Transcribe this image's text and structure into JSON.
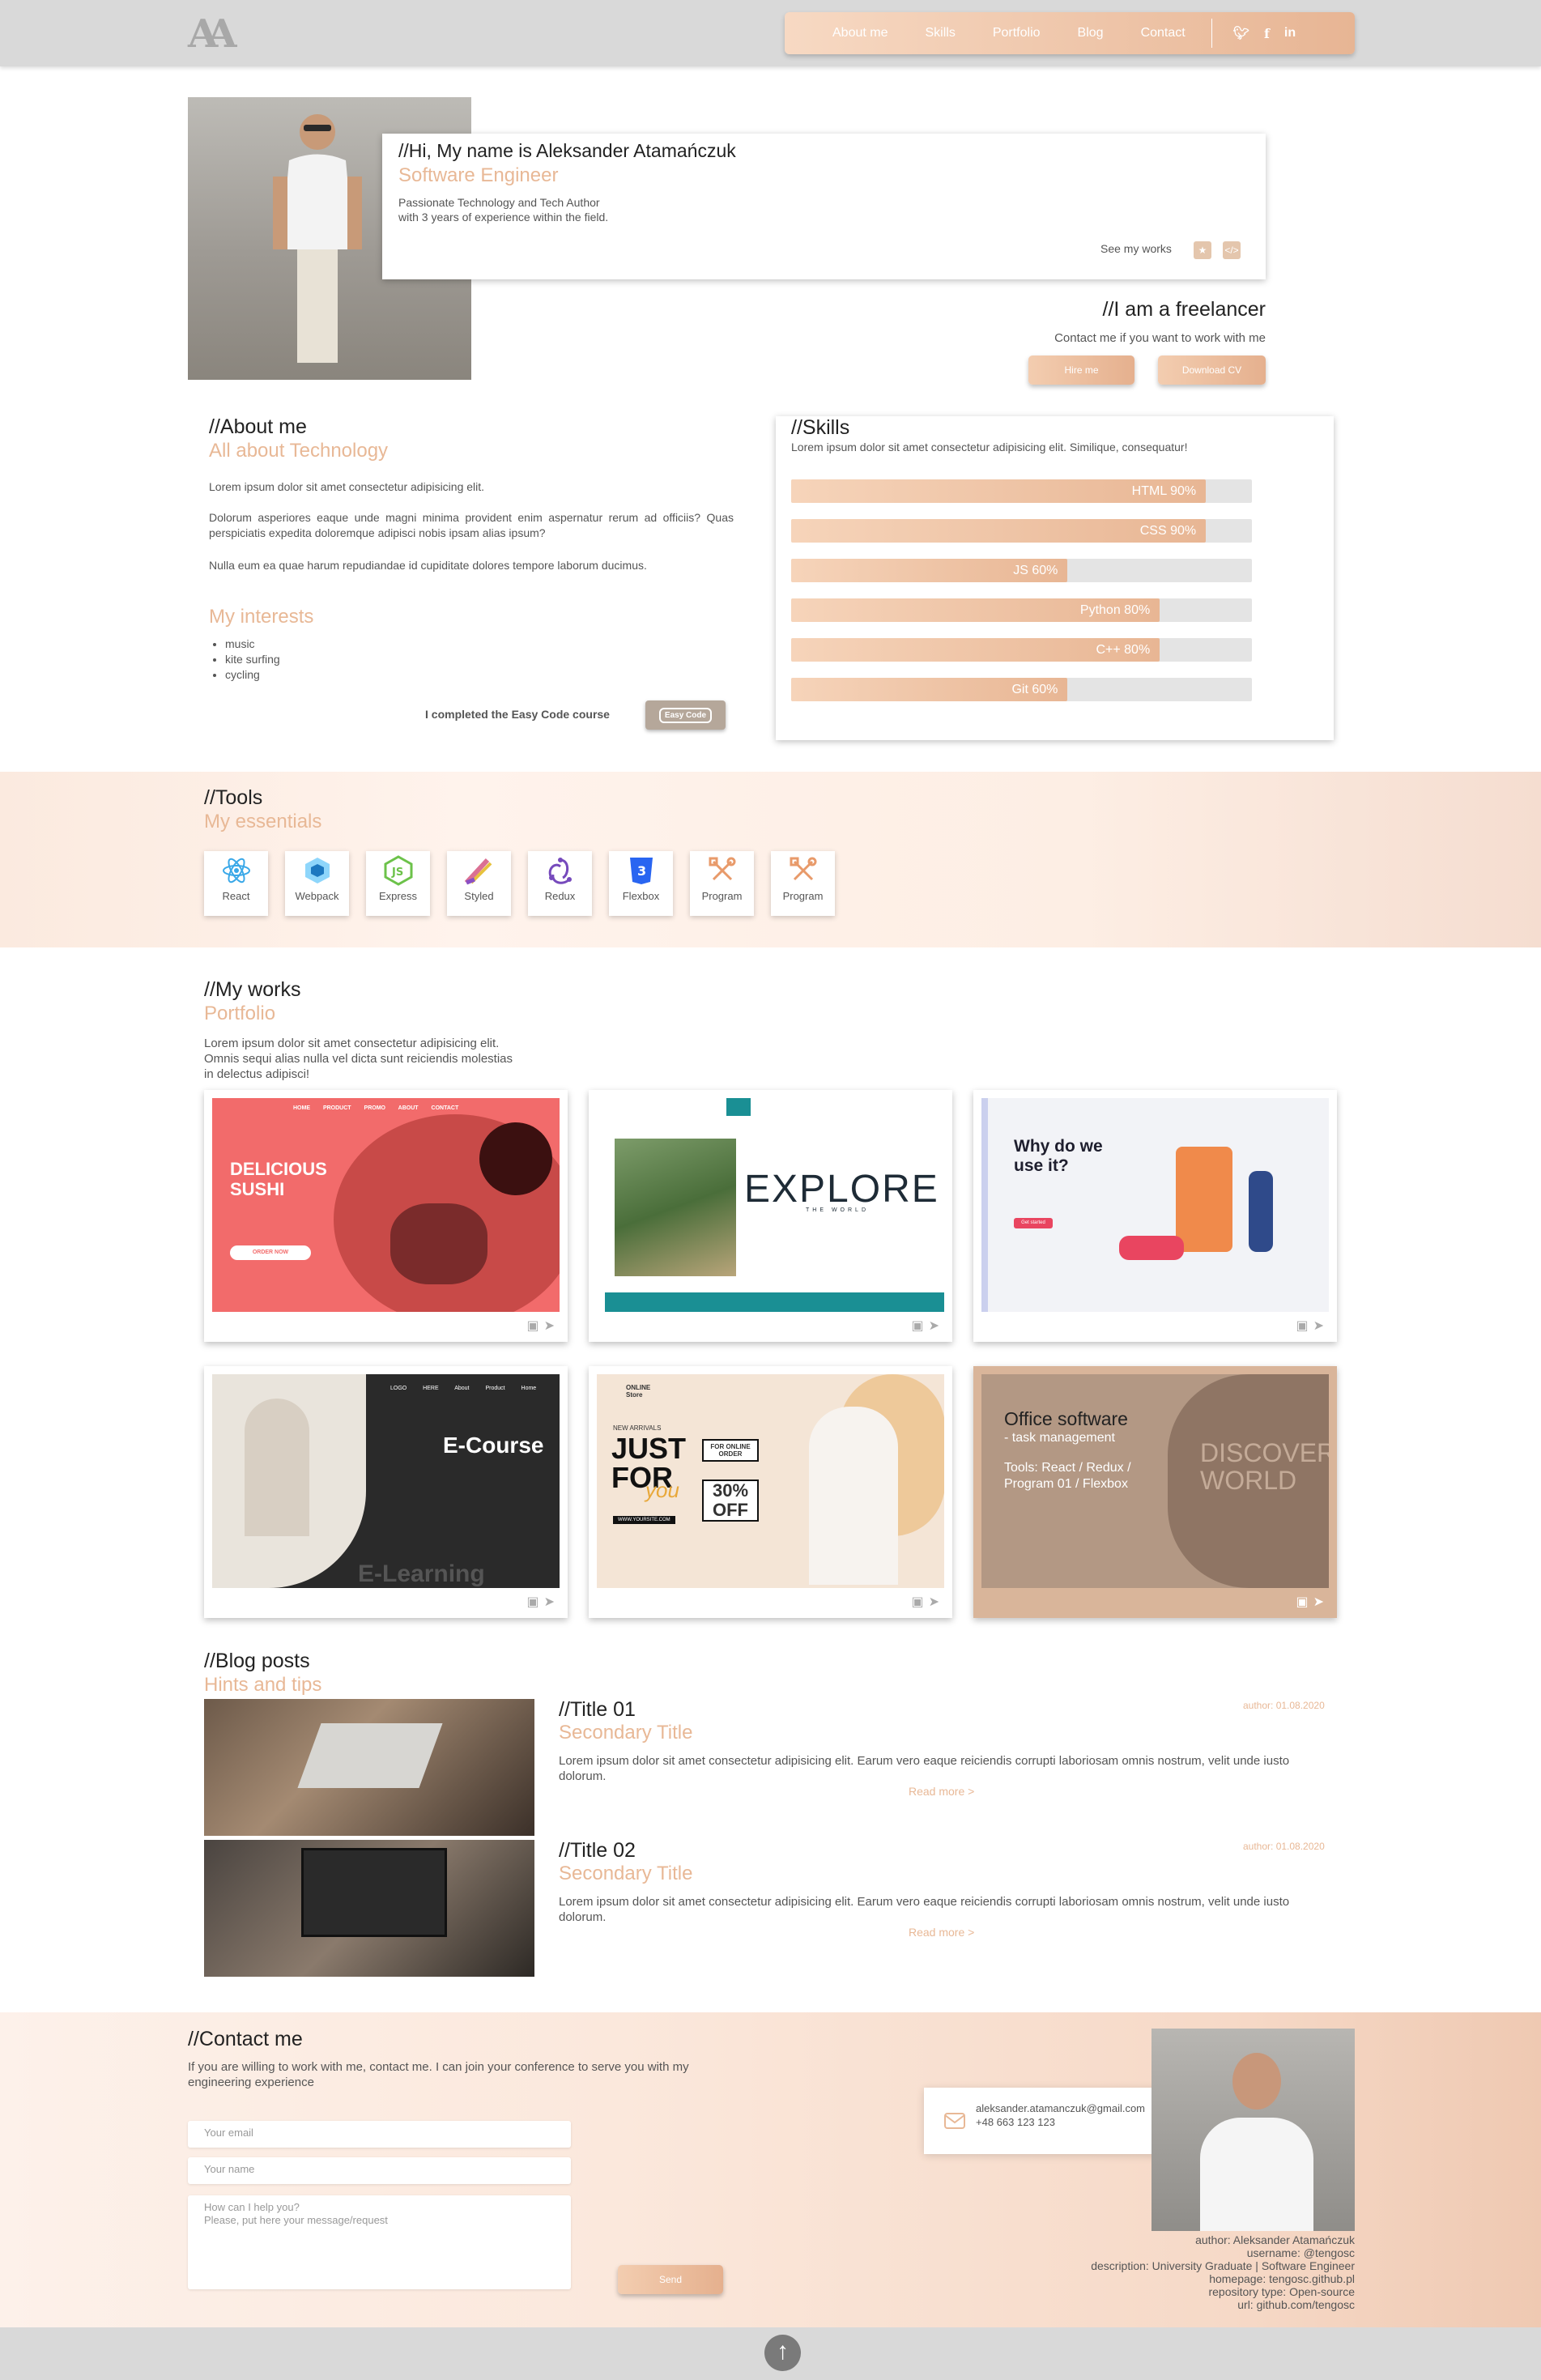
{
  "header": {
    "logo": "AA",
    "nav": [
      "About me",
      "Skills",
      "Portfolio",
      "Blog",
      "Contact"
    ],
    "social": [
      "twitter-icon",
      "facebook-icon",
      "linkedin-icon"
    ]
  },
  "hero": {
    "greeting": "//Hi, My name is Aleksander Atamańczuk",
    "role": "Software Engineer",
    "desc1": "Passionate Technology and Tech Author",
    "desc2": "with 3 years of experience within the field.",
    "see_works": "See my works",
    "freelancer_title": "//I am a freelancer",
    "freelancer_text": "Contact me if you want to work with me",
    "hire": "Hire me",
    "cv": "Download CV"
  },
  "about": {
    "title": "//About me",
    "subtitle": "All about Technology",
    "p1": "Lorem ipsum dolor sit amet consectetur adipisicing elit.",
    "p2": "Dolorum asperiores eaque unde magni minima provident enim aspernatur rerum ad officiis? Quas perspiciatis expedita doloremque adipisci nobis ipsam alias ipsum?",
    "p3": "Nulla eum ea quae harum repudiandae id cupiditate dolores tempore laborum ducimus.",
    "interests_title": "My interests",
    "interests": [
      "music",
      "kite surfing",
      "cycling"
    ],
    "course_text": "I completed the Easy Code course",
    "course_badge": "Easy Code"
  },
  "skills": {
    "title": "//Skills",
    "desc": "Lorem ipsum dolor sit amet consectetur adipisicing elit. Similique, consequatur!",
    "items": [
      {
        "label": "HTML 90%",
        "value": 90
      },
      {
        "label": "CSS 90%",
        "value": 90
      },
      {
        "label": "JS 60%",
        "value": 60
      },
      {
        "label": "Python 80%",
        "value": 80
      },
      {
        "label": "C++ 80%",
        "value": 80
      },
      {
        "label": "Git 60%",
        "value": 60
      }
    ]
  },
  "tools": {
    "title": "//Tools",
    "subtitle": "My essentials",
    "items": [
      "React",
      "Webpack",
      "Express",
      "Styled",
      "Redux",
      "Flexbox",
      "Program",
      "Program"
    ]
  },
  "works": {
    "title": "//My works",
    "subtitle": "Portfolio",
    "desc": "Lorem ipsum dolor sit amet consectetur adipisicing elit. Omnis sequi alias nulla vel dicta sunt reiciendis molestias in delectus adipisci!",
    "sushi_title": "DELICIOUS SUSHI",
    "sushi_btn": "ORDER NOW",
    "sushi_nav": [
      "HOME",
      "PRODUCT",
      "PROMO",
      "ABOUT",
      "CONTACT"
    ],
    "explore": "EXPLORE",
    "explore_sub": "THE WORLD",
    "why_title": "Why do we use it?",
    "why_btn": "Get started",
    "ecourse": "E-Course",
    "ecourse_bottom": "E-Learning",
    "ecourse_nav": [
      "LOGO HERE",
      "About",
      "Product",
      "Home"
    ],
    "fashion_new": "NEW ARRIVALS",
    "fashion_big": "JUST FOR",
    "fashion_you": "you",
    "fashion_online": "FOR ONLINE ORDER",
    "fashion_off": "30% OFF",
    "fashion_logo": "ONLINE Store",
    "fashion_site": "WWW.YOURSITE.COM",
    "office_title": "Office software",
    "office_sub": "- task management",
    "office_tools": "Tools: React / Redux / Program 01 / Flexbox",
    "office_bg": "DISCOVER WORLD"
  },
  "blog": {
    "title": "//Blog posts",
    "subtitle": "Hints and tips",
    "posts": [
      {
        "title": "//Title 01",
        "secondary": "Secondary Title",
        "text": "Lorem ipsum dolor sit amet consectetur adipisicing elit. Earum vero eaque reiciendis corrupti laboriosam omnis nostrum, velit unde iusto dolorum.",
        "author": "author: 01.08.2020",
        "more": "Read more >"
      },
      {
        "title": "//Title 02",
        "secondary": "Secondary Title",
        "text": "Lorem ipsum dolor sit amet consectetur adipisicing elit. Earum vero eaque reiciendis corrupti laboriosam omnis nostrum, velit unde iusto dolorum.",
        "author": "author: 01.08.2020",
        "more": "Read more >"
      }
    ]
  },
  "contact": {
    "title": "//Contact me",
    "desc": "If you are willing to work with me, contact me. I can join your conference to serve you with my engineering experience",
    "email_ph": "Your email",
    "name_ph": "Your name",
    "msg_ph": "How can I help you?\nPlease, put here your message/request",
    "send": "Send",
    "email": "aleksander.atamanczuk@gmail.com",
    "phone": "+48 663 123 123",
    "info": [
      "author: Aleksander Atamańczuk",
      "username: @tengosc",
      "description: University Graduate | Software Engineer",
      "homepage: tengosc.github.pl",
      "repository type: Open-source",
      "url: github.com/tengosc"
    ]
  },
  "colors": {
    "accent": "#e8b896",
    "header_bg": "#d9d9d9"
  }
}
